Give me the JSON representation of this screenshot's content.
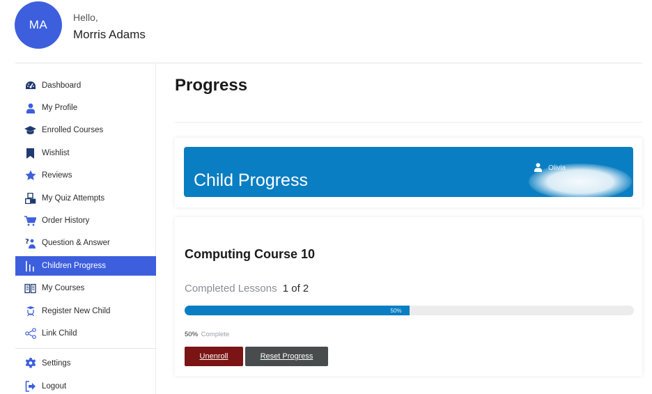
{
  "header": {
    "avatar_initials": "MA",
    "greeting": "Hello,",
    "user_name": "Morris Adams",
    "avatar_color": "#3d5fde"
  },
  "sidebar": {
    "accent": "#3d5fde",
    "items": [
      {
        "label": "Dashboard",
        "icon": "dashboard-gauge-icon",
        "active": false
      },
      {
        "label": "My Profile",
        "icon": "user-icon",
        "active": false
      },
      {
        "label": "Enrolled Courses",
        "icon": "graduation-cap-icon",
        "active": false
      },
      {
        "label": "Wishlist",
        "icon": "bookmark-icon",
        "active": false
      },
      {
        "label": "Reviews",
        "icon": "star-icon",
        "active": false
      },
      {
        "label": "My Quiz Attempts",
        "icon": "quiz-blocks-icon",
        "active": false
      },
      {
        "label": "Order History",
        "icon": "cart-icon",
        "active": false
      },
      {
        "label": "Question & Answer",
        "icon": "question-answer-icon",
        "active": false
      },
      {
        "label": "Children Progress",
        "icon": "bar-chart-icon",
        "active": true
      },
      {
        "label": "My Courses",
        "icon": "book-icon",
        "active": false
      },
      {
        "label": "Register New Child",
        "icon": "child-register-icon",
        "active": false
      },
      {
        "label": "Link Child",
        "icon": "share-link-icon",
        "active": false
      }
    ],
    "bottom_items": [
      {
        "label": "Settings",
        "icon": "gear-icon"
      },
      {
        "label": "Logout",
        "icon": "logout-icon"
      }
    ]
  },
  "main": {
    "page_title": "Progress",
    "banner": {
      "title": "Child Progress",
      "child_name": "Olivia",
      "child_icon": "user-icon",
      "color": "#0a7ec2"
    },
    "course": {
      "title": "Computing Course 10",
      "lessons_label": "Completed Lessons",
      "lessons_value": "1 of 2",
      "progress_percent": 50,
      "progress_label": "50%",
      "complete_percent": "50%",
      "complete_word": "Complete",
      "unenroll_label": "Unenroll",
      "reset_label": "Reset Progress",
      "unenroll_color": "#7b1414",
      "reset_color": "#494c4f"
    }
  }
}
